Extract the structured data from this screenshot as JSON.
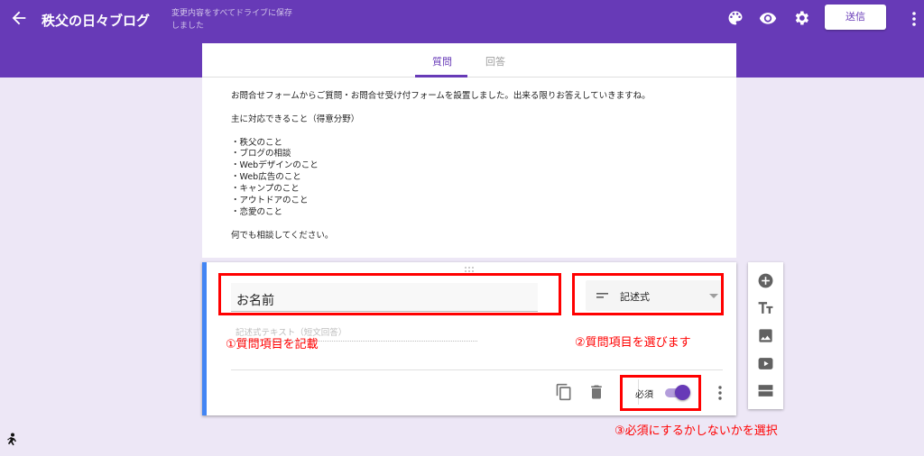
{
  "app": {
    "title": "秩父の日々ブログ",
    "save_status": "変更内容をすべてドライブに保存しました",
    "send_label": "送信"
  },
  "tabs": [
    {
      "label": "質問",
      "active": true
    },
    {
      "label": "回答",
      "active": false
    }
  ],
  "description": [
    "お問合せフォームからご質問・お問合せ受け付フォームを設置しました。出来る限りお答えしていきますね。",
    "",
    "主に対応できること（得意分野）",
    "",
    "・秩父のこと",
    "・ブログの相談",
    "・Webデザインのこと",
    "・Web広告のこと",
    "・キャンプのこと",
    "・アウトドアのこと",
    "・恋愛のこと",
    "",
    "何でも相談してください。"
  ],
  "question": {
    "title": "お名前",
    "type": "記述式",
    "answer_hint": "記述式テキスト（短文回答）",
    "required_label": "必須",
    "required": true
  },
  "annotations": {
    "one": "①質問項目を記載",
    "two": "②質問項目を選びます",
    "three": "③必須にするかしないかを選択"
  },
  "colors": {
    "primary": "#673ab7",
    "background": "#ede7f6",
    "annotation": "#ff0000",
    "focus_border": "#4285f4"
  },
  "icons": {
    "top": [
      "arrow-back-icon",
      "palette-icon",
      "eye-icon",
      "settings-icon",
      "more-vert-icon"
    ],
    "question_footer": [
      "duplicate-icon",
      "trash-icon",
      "more-vert-icon"
    ],
    "sidebar": [
      "add-question-icon",
      "add-title-icon",
      "add-image-icon",
      "add-video-icon",
      "add-section-icon"
    ]
  }
}
